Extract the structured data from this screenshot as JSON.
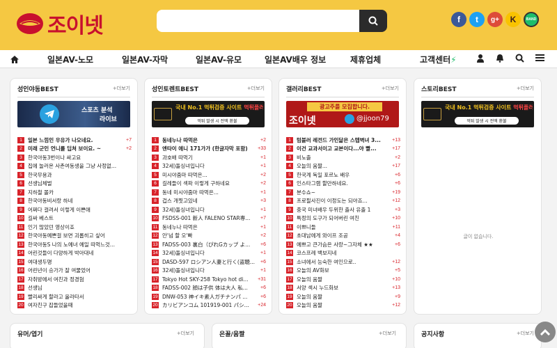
{
  "header": {
    "logo_text": "조이넷",
    "search_placeholder": "",
    "social": [
      {
        "icon": "facebook-icon",
        "glyph": "f",
        "color": "#3b5998"
      },
      {
        "icon": "twitter-icon",
        "glyph": "t",
        "color": "#1da1f2"
      },
      {
        "icon": "google-plus-icon",
        "glyph": "g+",
        "color": "#dd4b39"
      },
      {
        "icon": "kakao-icon",
        "glyph": "K",
        "color": "#f9c300"
      },
      {
        "icon": "band-icon",
        "glyph": "BAND",
        "color": "#1ebd6b"
      }
    ]
  },
  "nav": {
    "items": [
      "일본AV-노모",
      "일본AV-자막",
      "일본AV-유모",
      "일본AV배우 정보",
      "제휴업체",
      "고객센터"
    ]
  },
  "panels": [
    {
      "title": "성인야동BEST",
      "more": "+더보기",
      "banner": {
        "line1": "스포츠 분석",
        "line2": "라이브",
        "caption": ""
      },
      "rows": [
        {
          "n": "1",
          "t": "일본 느낌인 우유가 나오네요.",
          "c": "+7",
          "b": true
        },
        {
          "n": "2",
          "t": "미래 군인 언니를 딥쳐 보이요. ~",
          "c": "+2",
          "b": true
        },
        {
          "n": "3",
          "t": "한국야동3번이나 싸고요",
          "c": "",
          "b": false
        },
        {
          "n": "4",
          "t": "집에 놀러온 사촌여동생을 그냥 사정없...",
          "c": "",
          "b": false
        },
        {
          "n": "5",
          "t": "한국무용과",
          "c": "",
          "b": false
        },
        {
          "n": "6",
          "t": "선생님체벌",
          "c": "",
          "b": false
        },
        {
          "n": "7",
          "t": "지하철 몰카",
          "c": "",
          "b": false
        },
        {
          "n": "8",
          "t": "한국야동비서랑 하네",
          "c": "",
          "b": false
        },
        {
          "n": "9",
          "t": "어쩌다 걸려서 이렇게 이쁜애",
          "c": "",
          "b": false
        },
        {
          "n": "10",
          "t": "길싸 베스트",
          "c": "",
          "b": false
        },
        {
          "n": "11",
          "t": "인기 많았던 영상이죠",
          "c": "",
          "b": false
        },
        {
          "n": "12",
          "t": "한국야동예쁜걸 보면 괴롭히고 싶어",
          "c": "",
          "b": false
        },
        {
          "n": "13",
          "t": "한국야동S 나의 노예녀 예일 따먹느것...",
          "c": "",
          "b": false
        },
        {
          "n": "14",
          "t": "어린것들이 다양하게 박아대네",
          "c": "",
          "b": false
        },
        {
          "n": "15",
          "t": "여대생두명",
          "c": "",
          "b": false
        },
        {
          "n": "16",
          "t": "어린년이 승가가 잘 여물었어",
          "c": "",
          "b": false
        },
        {
          "n": "17",
          "t": "자취방에서 여친과 정경험",
          "c": "",
          "b": false
        },
        {
          "n": "18",
          "t": "선생님",
          "c": "",
          "b": false
        },
        {
          "n": "19",
          "t": "빨리싸게 할라고 올라타서",
          "c": "",
          "b": false
        },
        {
          "n": "20",
          "t": "여자친구 잡들었을때",
          "c": "",
          "b": false
        }
      ]
    },
    {
      "title": "성인토렌트BEST",
      "more": "+더보기",
      "banner": {
        "line1": "국내 No.1 먹튀검증 사이트",
        "line2": "먹튀플러스",
        "caption": "먹튀 발생 시 전액 환불"
      },
      "rows": [
        {
          "n": "1",
          "t": "동네누나 따먹은",
          "c": "+2",
          "b": true
        },
        {
          "n": "2",
          "t": "엔타이 에니 171가가 (한글자막 포함)",
          "c": "+33",
          "b": true
        },
        {
          "n": "3",
          "t": "과호배 따먹기",
          "c": "+1",
          "b": false
        },
        {
          "n": "4",
          "t": "32세)돌싱녀입니다",
          "c": "+1",
          "b": false
        },
        {
          "n": "5",
          "t": "미시야줌마 따먹은...",
          "c": "+2",
          "b": false
        },
        {
          "n": "6",
          "t": "길레들이 섹파 이렇게 구하네요",
          "c": "+2",
          "b": false
        },
        {
          "n": "7",
          "t": "동네 미시야줌마 따먹은...",
          "c": "+1",
          "b": false
        },
        {
          "n": "8",
          "t": "겁스 개찟고있네",
          "c": "+3",
          "b": false
        },
        {
          "n": "9",
          "t": "32세)돌싱녀입니다",
          "c": "+1",
          "b": false
        },
        {
          "n": "10",
          "t": "FSDSS-001 新人 FALENO STAR専...",
          "c": "+7",
          "b": false
        },
        {
          "n": "11",
          "t": "동네누나 따먹은",
          "c": "+1",
          "b": false
        },
        {
          "n": "12",
          "t": "안'넘 할 오'빠",
          "c": "+2",
          "b": false
        },
        {
          "n": "13",
          "t": "FADSS-003 裏白（ぴれGカップ よ...",
          "c": "+6",
          "b": false
        },
        {
          "n": "14",
          "t": "32세)돌싱녀입니다",
          "c": "+1",
          "b": false
        },
        {
          "n": "15",
          "t": "DASD-597 ロシアン人妻と行く(盗聴...",
          "c": "+6",
          "b": false
        },
        {
          "n": "16",
          "t": "32세)돌싱녀입니다",
          "c": "+1",
          "b": false
        },
        {
          "n": "17",
          "t": "Tokyo Hot SKY-258 Tokyo hot di...",
          "c": "+31",
          "b": false
        },
        {
          "n": "18",
          "t": "FADSS-002 顔は子供 体は大人 私...",
          "c": "+6",
          "b": false
        },
        {
          "n": "19",
          "t": "DNW-053 神イキ素人ガチナンパ ...",
          "c": "+6",
          "b": false
        },
        {
          "n": "20",
          "t": "カリビアンコム 101919-001 パシ...",
          "c": "+24",
          "b": false
        }
      ]
    },
    {
      "title": "갤러리BEST",
      "more": "+더보기",
      "banner": {
        "line1": "광고주를 모집합니다.",
        "line2": "조이넷",
        "caption": "@jjoon79"
      },
      "rows": [
        {
          "n": "1",
          "t": "텀블러 레전드 가인닮은 스텝벽녀 3...",
          "c": "+13",
          "b": true
        },
        {
          "n": "2",
          "t": "이건 교과서이고 교본이다...야 빨...",
          "c": "+17",
          "b": true
        },
        {
          "n": "3",
          "t": "비노출",
          "c": "+2",
          "b": false
        },
        {
          "n": "4",
          "t": "오늘의 움짤...",
          "c": "+17",
          "b": false
        },
        {
          "n": "5",
          "t": "한국계 독일 포르노 배우",
          "c": "+6",
          "b": false
        },
        {
          "n": "6",
          "t": "인스타그램 할만하네요.",
          "c": "+6",
          "b": false
        },
        {
          "n": "7",
          "t": "분수쇼~",
          "c": "+19",
          "b": false
        },
        {
          "n": "8",
          "t": "프로필사진이 이정도는 되야죠...",
          "c": "+12",
          "b": false
        },
        {
          "n": "9",
          "t": "중국 미녀배우 두위한 출사 유출 1",
          "c": "+3",
          "b": false
        },
        {
          "n": "10",
          "t": "특정의 도구가 되어버린 여친",
          "c": "+10",
          "b": false
        },
        {
          "n": "11",
          "t": "이쁘니들",
          "c": "+11",
          "b": false
        },
        {
          "n": "12",
          "t": "초대남에게 와이프 조공",
          "c": "+4",
          "b": false
        },
        {
          "n": "13",
          "t": "예쁘고 큰가슴은 사랑~그자체 ★★",
          "c": "+6",
          "b": false
        },
        {
          "n": "14",
          "t": "코스프레 백보지네",
          "c": "",
          "b": false
        },
        {
          "n": "15",
          "t": "소녀에서 능숙한 여인으로..",
          "c": "+12",
          "b": false
        },
        {
          "n": "16",
          "t": "오늘의 AV화보",
          "c": "+5",
          "b": false
        },
        {
          "n": "17",
          "t": "오늘의 움짤",
          "c": "+10",
          "b": false
        },
        {
          "n": "18",
          "t": "서양 섹시 누드화보",
          "c": "+13",
          "b": false
        },
        {
          "n": "19",
          "t": "오늘의 움짤",
          "c": "+9",
          "b": false
        },
        {
          "n": "20",
          "t": "오늘의 움짤",
          "c": "+12",
          "b": false
        }
      ]
    },
    {
      "title": "스토리BEST",
      "more": "+더보기",
      "banner": {
        "line1": "국내 No.1 먹튀검증 사이트",
        "line2": "먹튀플러스",
        "caption": "먹튀 발생 시 전액 환불"
      },
      "empty": "글이 없습니다.",
      "rows": []
    }
  ],
  "bottom_panels": [
    {
      "title": "유머/엽기",
      "more": "+더보기"
    },
    {
      "title": "은꼴/움짤",
      "more": "+더보기"
    },
    {
      "title": "공지사항",
      "more": "+더보기"
    }
  ],
  "colors": {
    "header_bg": "#f5c842",
    "accent": "#d8232a",
    "logo": "#c8102e"
  }
}
